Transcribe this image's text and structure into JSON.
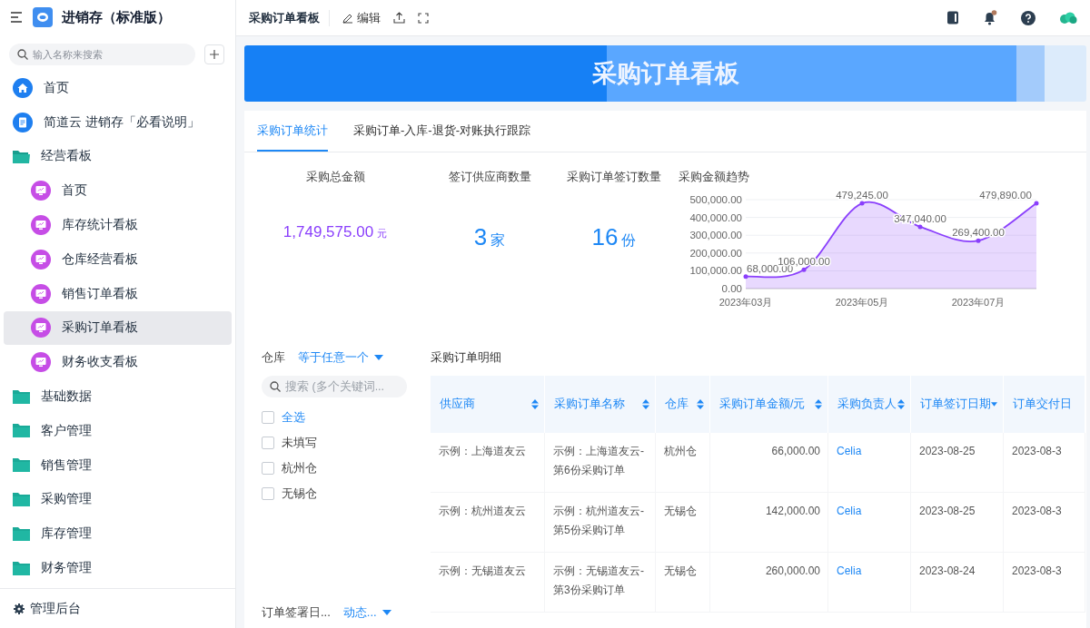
{
  "app": {
    "title": "进销存（标准版）",
    "search": {
      "placeholder": "输入名称来搜索"
    }
  },
  "sidebar": {
    "items": [
      {
        "kind": "home",
        "label": "首页",
        "selected": false
      },
      {
        "kind": "doc",
        "label": "简道云 进销存「必看说明」",
        "selected": false
      },
      {
        "kind": "folder",
        "label": "经营看板",
        "selected": false,
        "expanded": true,
        "children": [
          {
            "kind": "dashboard",
            "label": "首页",
            "selected": false
          },
          {
            "kind": "dashboard",
            "label": "库存统计看板",
            "selected": false
          },
          {
            "kind": "dashboard",
            "label": "仓库经营看板",
            "selected": false
          },
          {
            "kind": "dashboard",
            "label": "销售订单看板",
            "selected": false
          },
          {
            "kind": "dashboard",
            "label": "采购订单看板",
            "selected": true
          },
          {
            "kind": "dashboard",
            "label": "财务收支看板",
            "selected": false
          }
        ]
      },
      {
        "kind": "folder",
        "label": "基础数据",
        "selected": false,
        "expanded": false
      },
      {
        "kind": "folder",
        "label": "客户管理",
        "selected": false,
        "expanded": false
      },
      {
        "kind": "folder",
        "label": "销售管理",
        "selected": false,
        "expanded": false
      },
      {
        "kind": "folder",
        "label": "采购管理",
        "selected": false,
        "expanded": false
      },
      {
        "kind": "folder",
        "label": "库存管理",
        "selected": false,
        "expanded": false
      },
      {
        "kind": "folder",
        "label": "财务管理",
        "selected": false,
        "expanded": false
      }
    ],
    "footer": "管理后台"
  },
  "toolbar": {
    "title": "采购订单看板",
    "edit": "编辑"
  },
  "banner": {
    "title": "采购订单看板"
  },
  "tabs": [
    {
      "label": "采购订单统计",
      "selected": true
    },
    {
      "label": "采购订单-入库-退货-对账执行跟踪",
      "selected": false
    }
  ],
  "stats": [
    {
      "title": "采购总金额",
      "value": "1,749,575.00",
      "unit": "元",
      "color": "#8a3ffc"
    },
    {
      "title": "签订供应商数量",
      "value": "3",
      "unit": "家",
      "color": "#1e88f5"
    },
    {
      "title": "采购订单签订数量",
      "value": "16",
      "unit": "份",
      "color": "#1e88f5"
    }
  ],
  "trend": {
    "title": "采购金额趋势",
    "chart_data": {
      "type": "area",
      "categories": [
        "2023年03月",
        null,
        "2023年05月",
        null,
        "2023年07月",
        null
      ],
      "series": [
        {
          "color": "#8a3ffc",
          "values": [
            68000,
            106000,
            479245,
            347040,
            269400,
            479890
          ]
        }
      ],
      "value_labels": [
        "68,000.00",
        "106,000.00",
        "479,245.00",
        "347,040.00",
        "269,400.00",
        "479,890.00"
      ],
      "ylim": [
        0,
        500000
      ],
      "grid": true,
      "yticks": [
        {
          "value": 0,
          "label": "0.00"
        },
        {
          "value": 100000,
          "label": "100,000.00"
        },
        {
          "value": 200000,
          "label": "200,000.00"
        },
        {
          "value": 300000,
          "label": "300,000.00"
        },
        {
          "value": 400000,
          "label": "400,000.00"
        },
        {
          "value": 500000,
          "label": "500,000.00"
        }
      ]
    }
  },
  "filter": {
    "label": "仓库",
    "operator": "等于任意一个",
    "search_placeholder": "搜索 (多个关键词...",
    "options": [
      {
        "label": "全选",
        "checked": false,
        "selected": true
      },
      {
        "label": "未填写",
        "checked": false,
        "selected": false
      },
      {
        "label": "杭州仓",
        "checked": false,
        "selected": false
      },
      {
        "label": "无锡仓",
        "checked": false,
        "selected": false
      }
    ],
    "second_label": "订单签署日...",
    "second_operator": "动态..."
  },
  "table": {
    "title": "采购订单明细",
    "columns": [
      {
        "label": "供应商",
        "sorted_descending": false
      },
      {
        "label": "采购订单名称",
        "sorted_descending": false
      },
      {
        "label": "仓库",
        "sorted_descending": false
      },
      {
        "label": "采购订单金额/元",
        "sorted_descending": false
      },
      {
        "label": "采购负责人",
        "sorted_descending": false
      },
      {
        "label": "订单签订日期",
        "sorted_descending": true
      },
      {
        "label": "订单交付日"
      }
    ],
    "rows": [
      [
        "示例：上海道友云",
        "示例：上海道友云-第6份采购订单",
        "杭州仓",
        "66,000.00",
        "Celia",
        "2023-08-25",
        "2023-08-3"
      ],
      [
        "示例：杭州道友云",
        "示例：杭州道友云-第5份采购订单",
        "无锡仓",
        "142,000.00",
        "Celia",
        "2023-08-25",
        "2023-08-3"
      ],
      [
        "示例：无锡道友云",
        "示例：无锡道友云-第3份采购订单",
        "无锡仓",
        "260,000.00",
        "Celia",
        "2023-08-24",
        "2023-08-3"
      ]
    ]
  }
}
